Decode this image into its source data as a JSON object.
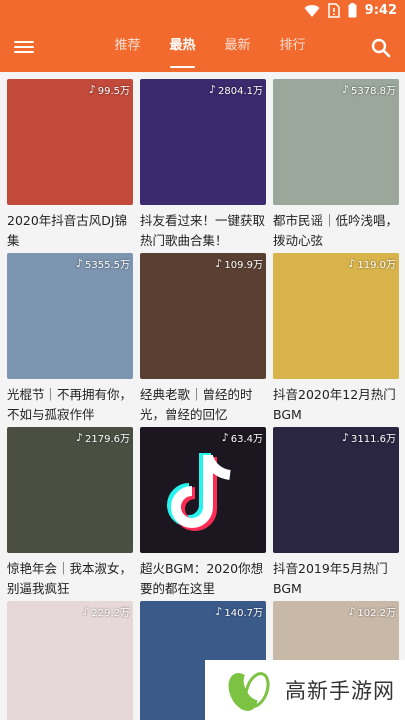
{
  "status": {
    "time": "9:42"
  },
  "appbar": {
    "tabs": [
      {
        "label": "推荐",
        "active": false
      },
      {
        "label": "最热",
        "active": true
      },
      {
        "label": "最新",
        "active": false
      },
      {
        "label": "排行",
        "active": false
      }
    ]
  },
  "cards": [
    {
      "count": "99.5万",
      "title": "2020年抖音古风DJ锦集",
      "bg": "#c24a3a"
    },
    {
      "count": "2804.1万",
      "title": "抖友看过来！一键获取热门歌曲合集！",
      "bg": "#3b2a6d"
    },
    {
      "count": "5378.8万",
      "title": "都市民谣｜低吟浅唱，拨动心弦",
      "bg": "#9aa79a"
    },
    {
      "count": "5355.5万",
      "title": "光棍节｜不再拥有你，不如与孤寂作伴",
      "bg": "#7c95b0"
    },
    {
      "count": "109.9万",
      "title": "经典老歌｜曾经的时光，曾经的回忆",
      "bg": "#5a4032"
    },
    {
      "count": "119.0万",
      "title": "抖音2020年12月热门BGM",
      "bg": "#d8b44a"
    },
    {
      "count": "2179.6万",
      "title": "惊艳年会｜我本淑女，别逼我疯狂",
      "bg": "#4a4f42"
    },
    {
      "count": "63.4万",
      "title": "超火BGM：2020你想要的都在这里",
      "bg": "#1c1620"
    },
    {
      "count": "3111.6万",
      "title": "抖音2019年5月热门BGM",
      "bg": "#2a2540"
    },
    {
      "count": "229.2万",
      "title": "",
      "bg": "#e6d8d8"
    },
    {
      "count": "140.7万",
      "title": "",
      "bg": "#3a5a8a"
    },
    {
      "count": "102.2万",
      "title": "",
      "bg": "#c8b8a8"
    }
  ],
  "watermark": {
    "text": "高新手游网"
  },
  "colors": {
    "primary": "#f26a2e",
    "logo_green": "#7cc243"
  }
}
